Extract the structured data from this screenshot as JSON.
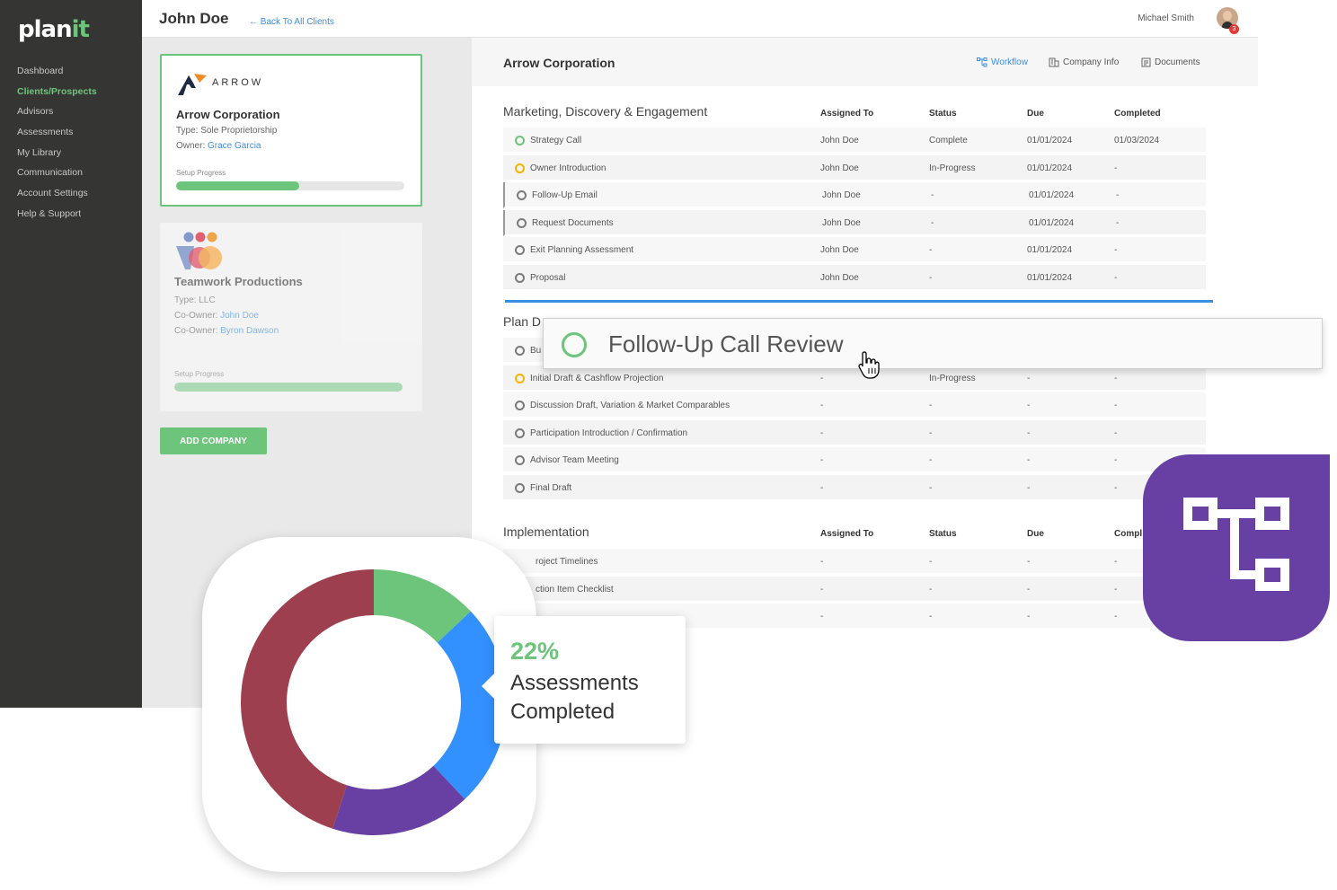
{
  "sidebar": {
    "logo": {
      "plan": "plan",
      "it": "it"
    },
    "items": [
      {
        "label": "Dashboard"
      },
      {
        "label": "Clients/Prospects"
      },
      {
        "label": "Advisors"
      },
      {
        "label": "Assessments"
      },
      {
        "label": "My Library"
      },
      {
        "label": "Communication"
      },
      {
        "label": "Account Settings"
      },
      {
        "label": "Help & Support"
      }
    ],
    "active_index": 1
  },
  "header": {
    "client_name": "John Doe",
    "back_link": "← Back To All Clients",
    "user_name": "Michael Smith",
    "notification_count": "3"
  },
  "companies": [
    {
      "logo_text": "ARROW",
      "name": "Arrow Corporation",
      "type": "Type: Sole Proprietorship",
      "owner_label": "Owner: ",
      "owner": "Grace Garcia",
      "progress_label": "Setup Progress",
      "progress": 0.54
    },
    {
      "name": "Teamwork Productions",
      "type": "Type: LLC",
      "coowner1_label": "Co-Owner: ",
      "coowner1": "John Doe",
      "coowner2_label": "Co-Owner: ",
      "coowner2": "Byron Dawson",
      "progress_label": "Setup Progress",
      "progress": 1.0
    }
  ],
  "add_company_label": "ADD COMPANY",
  "panel": {
    "title": "Arrow Corporation",
    "tabs": [
      {
        "label": "Workflow",
        "icon": "workflow-icon"
      },
      {
        "label": "Company Info",
        "icon": "building-icon"
      },
      {
        "label": "Documents",
        "icon": "document-icon"
      }
    ],
    "columns": {
      "assigned": "Assigned To",
      "status": "Status",
      "due": "Due",
      "completed": "Completed",
      "completed_cut": "Compl"
    },
    "sections": [
      {
        "title": "Marketing, Discovery & Engagement",
        "rows": [
          {
            "name": "Strategy Call",
            "assigned": "John Doe",
            "status": "Complete",
            "due": "01/01/2024",
            "completed": "01/03/2024",
            "state": "green"
          },
          {
            "name": "Owner Introduction",
            "assigned": "John Doe",
            "status": "In-Progress",
            "due": "01/01/2024",
            "completed": "-",
            "state": "yellow"
          },
          {
            "name": "Follow-Up Email",
            "assigned": "John Doe",
            "status": "-",
            "due": "01/01/2024",
            "completed": "-",
            "state": "gray"
          },
          {
            "name": "Request Documents",
            "assigned": "John Doe",
            "status": "-",
            "due": "01/01/2024",
            "completed": "-",
            "state": "gray"
          },
          {
            "name": "Exit Planning Assessment",
            "assigned": "John Doe",
            "status": "-",
            "due": "01/01/2024",
            "completed": "-",
            "state": "gray"
          },
          {
            "name": "Proposal",
            "assigned": "John Doe",
            "status": "-",
            "due": "01/01/2024",
            "completed": "-",
            "state": "gray"
          }
        ]
      },
      {
        "title": "Plan D",
        "rows": [
          {
            "name": "Bu",
            "assigned": "",
            "status": "",
            "due": "",
            "completed": "",
            "state": "gray"
          },
          {
            "name": "Initial Draft & Cashflow Projection",
            "assigned": "-",
            "status": "In-Progress",
            "due": "-",
            "completed": "-",
            "state": "yellow"
          },
          {
            "name": "Discussion Draft, Variation & Market Comparables",
            "assigned": "-",
            "status": "-",
            "due": "-",
            "completed": "-",
            "state": "gray"
          },
          {
            "name": "Participation Introduction / Confirmation",
            "assigned": "-",
            "status": "-",
            "due": "-",
            "completed": "-",
            "state": "gray"
          },
          {
            "name": "Advisor Team Meeting",
            "assigned": "-",
            "status": "-",
            "due": "-",
            "completed": "-",
            "state": "gray"
          },
          {
            "name": "Final Draft",
            "assigned": "-",
            "status": "-",
            "due": "-",
            "completed": "-",
            "state": "gray"
          }
        ]
      },
      {
        "title": "Implementation",
        "rows": [
          {
            "name": "roject Timelines",
            "assigned": "-",
            "status": "-",
            "due": "-",
            "completed": "-"
          },
          {
            "name": "ction Item Checklist",
            "assigned": "-",
            "status": "-",
            "due": "-",
            "completed": "-"
          },
          {
            "name": "",
            "assigned": "-",
            "status": "-",
            "due": "-",
            "completed": "-"
          }
        ]
      }
    ]
  },
  "drag_item": {
    "label": "Follow-Up Call Review"
  },
  "stat": {
    "percent": "22%",
    "label_line1": "Assessments",
    "label_line2": "Completed"
  },
  "chart_data": {
    "type": "pie",
    "donut": true,
    "values": [
      0.13,
      0.25,
      0.17,
      0.45
    ],
    "colors": [
      "#6cc57b",
      "#3390ff",
      "#683fa2",
      "#9e3f4f"
    ]
  },
  "colors": {
    "accent": "#6cc57b",
    "link": "#3b8ee0",
    "sidebar": "#353633",
    "badge": "#683fa2"
  }
}
